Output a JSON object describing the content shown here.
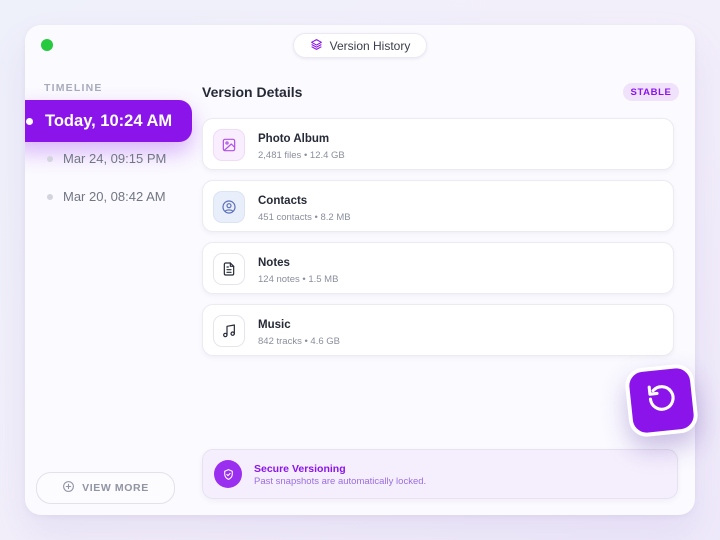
{
  "window": {
    "title": "Version History",
    "title_icon": "layers-icon",
    "status_dot_color": "#27c93f"
  },
  "sidebar": {
    "section_label": "TIMELINE",
    "items": [
      {
        "label": "Today, 10:24 AM",
        "active": true
      },
      {
        "label": "Mar 24, 09:15 PM",
        "active": false
      },
      {
        "label": "Mar 20, 08:42 AM",
        "active": false
      }
    ],
    "view_more_label": "VIEW MORE",
    "view_more_icon": "plus-circle-icon"
  },
  "main": {
    "title": "Version Details",
    "badge": "STABLE",
    "items": [
      {
        "name": "Photo Album",
        "meta": "2,481 files • 12.4 GB",
        "icon": "image-icon"
      },
      {
        "name": "Contacts",
        "meta": "451 contacts • 8.2 MB",
        "icon": "user-circle-icon"
      },
      {
        "name": "Notes",
        "meta": "124 notes • 1.5 MB",
        "icon": "document-icon"
      },
      {
        "name": "Music",
        "meta": "842 tracks • 4.6 GB",
        "icon": "music-note-icon"
      }
    ]
  },
  "secure": {
    "title": "Secure Versioning",
    "subtitle": "Past snapshots are automatically locked.",
    "icon": "shield-icon"
  },
  "restore_button": {
    "icon": "restore-icon"
  },
  "colors": {
    "accent": "#8a14ea",
    "accent_soft": "#f1e2fc",
    "text_primary": "#262a37",
    "text_muted": "#8b8f9d"
  }
}
